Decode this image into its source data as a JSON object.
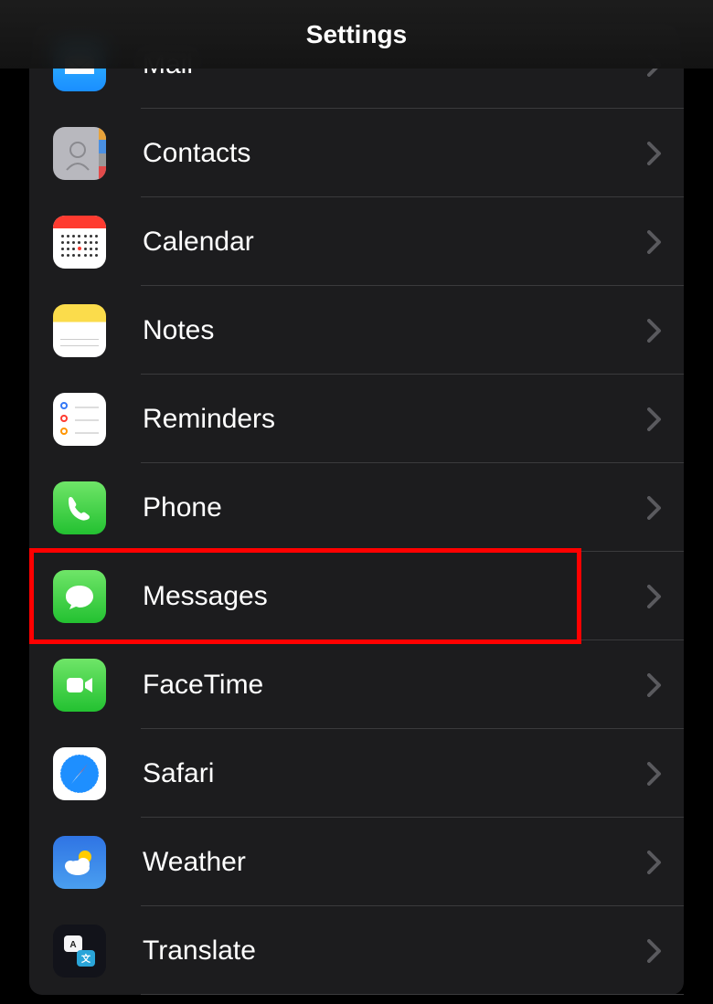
{
  "header": {
    "title": "Settings"
  },
  "rows": [
    {
      "id": "mail",
      "label": "Mail",
      "icon": "mail-icon"
    },
    {
      "id": "contacts",
      "label": "Contacts",
      "icon": "contacts-icon"
    },
    {
      "id": "calendar",
      "label": "Calendar",
      "icon": "calendar-icon"
    },
    {
      "id": "notes",
      "label": "Notes",
      "icon": "notes-icon"
    },
    {
      "id": "reminders",
      "label": "Reminders",
      "icon": "reminders-icon"
    },
    {
      "id": "phone",
      "label": "Phone",
      "icon": "phone-icon"
    },
    {
      "id": "messages",
      "label": "Messages",
      "icon": "messages-icon",
      "highlighted": true
    },
    {
      "id": "facetime",
      "label": "FaceTime",
      "icon": "facetime-icon"
    },
    {
      "id": "safari",
      "label": "Safari",
      "icon": "safari-icon"
    },
    {
      "id": "weather",
      "label": "Weather",
      "icon": "weather-icon"
    },
    {
      "id": "translate",
      "label": "Translate",
      "icon": "translate-icon"
    }
  ],
  "highlight_color": "#ff0000"
}
